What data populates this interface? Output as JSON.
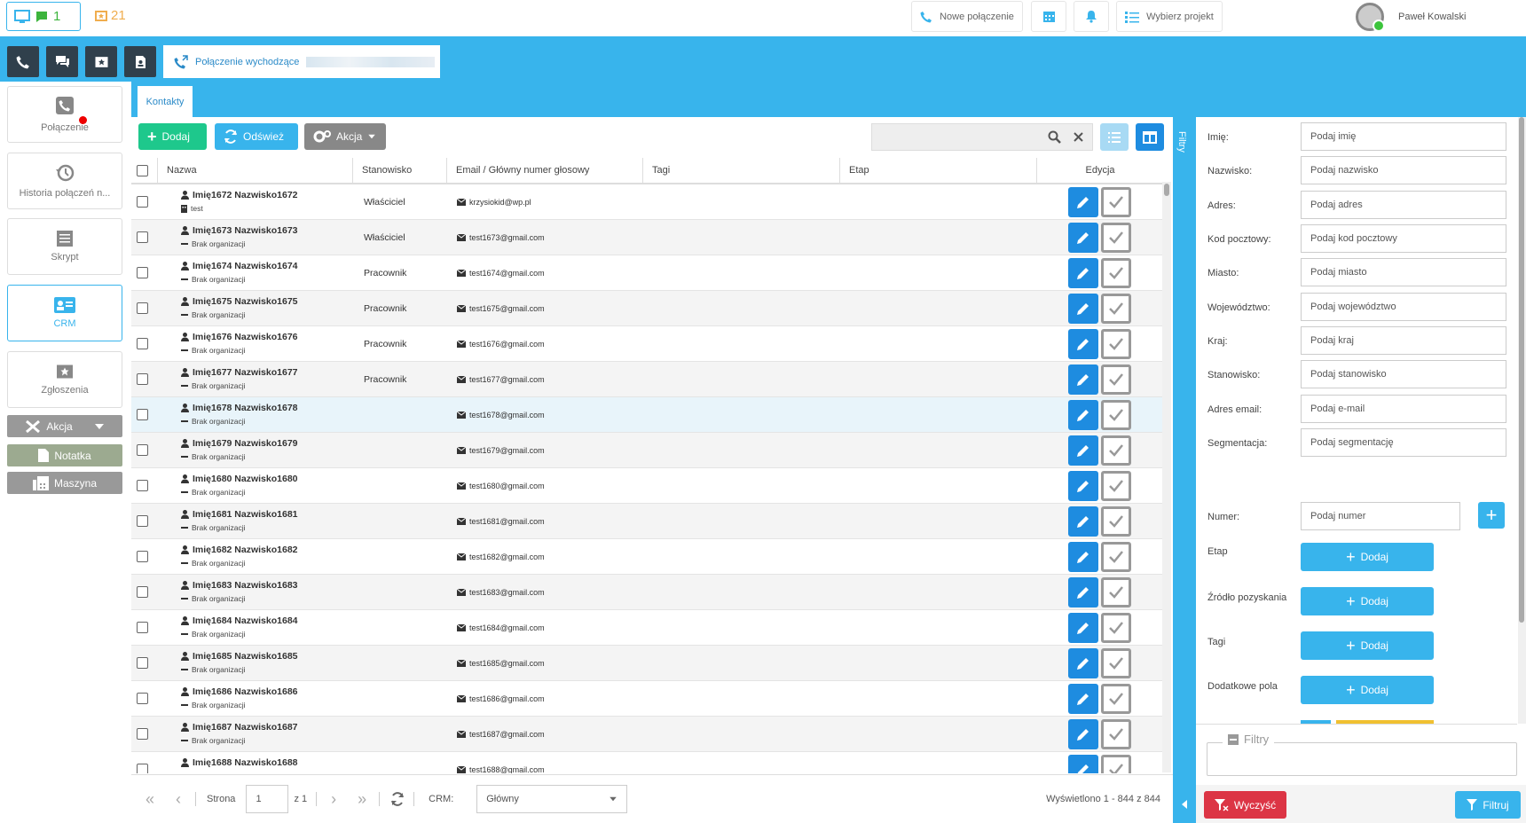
{
  "topbar": {
    "status_count": "1",
    "tickets_count": "21",
    "new_call": "Nowe połączenie",
    "project": "Wybierz projekt",
    "user_name": "Paweł Kowalski"
  },
  "call_tab": {
    "label": "Połączenie wychodzące"
  },
  "tab": {
    "label": "Kontakty"
  },
  "sidebar": {
    "polaczenie": "Połączenie",
    "historia": "Historia połączeń n...",
    "skrypt": "Skrypt",
    "crm": "CRM",
    "zgloszenia": "Zgłoszenia",
    "akcja": "Akcja",
    "notatka": "Notatka",
    "maszyna": "Maszyna"
  },
  "toolbar": {
    "add": "Dodaj",
    "refresh": "Odśwież",
    "action": "Akcja"
  },
  "table": {
    "headers": {
      "name": "Nazwa",
      "position": "Stanowisko",
      "email": "Email / Główny numer głosowy",
      "tags": "Tagi",
      "stage": "Etap",
      "edit": "Edycja"
    },
    "rows": [
      {
        "name": "Imię1672 Nazwisko1672",
        "org": "test",
        "position": "Właściciel",
        "email": "krzysiokid@wp.pl"
      },
      {
        "name": "Imię1673 Nazwisko1673",
        "org": "Brak organizacji",
        "position": "Właściciel",
        "email": "test1673@gmail.com"
      },
      {
        "name": "Imię1674 Nazwisko1674",
        "org": "Brak organizacji",
        "position": "Pracownik",
        "email": "test1674@gmail.com"
      },
      {
        "name": "Imię1675 Nazwisko1675",
        "org": "Brak organizacji",
        "position": "Pracownik",
        "email": "test1675@gmail.com"
      },
      {
        "name": "Imię1676 Nazwisko1676",
        "org": "Brak organizacji",
        "position": "Pracownik",
        "email": "test1676@gmail.com"
      },
      {
        "name": "Imię1677 Nazwisko1677",
        "org": "Brak organizacji",
        "position": "Pracownik",
        "email": "test1677@gmail.com"
      },
      {
        "name": "Imię1678 Nazwisko1678",
        "org": "Brak organizacji",
        "position": "",
        "email": "test1678@gmail.com"
      },
      {
        "name": "Imię1679 Nazwisko1679",
        "org": "Brak organizacji",
        "position": "",
        "email": "test1679@gmail.com"
      },
      {
        "name": "Imię1680 Nazwisko1680",
        "org": "Brak organizacji",
        "position": "",
        "email": "test1680@gmail.com"
      },
      {
        "name": "Imię1681 Nazwisko1681",
        "org": "Brak organizacji",
        "position": "",
        "email": "test1681@gmail.com"
      },
      {
        "name": "Imię1682 Nazwisko1682",
        "org": "Brak organizacji",
        "position": "",
        "email": "test1682@gmail.com"
      },
      {
        "name": "Imię1683 Nazwisko1683",
        "org": "Brak organizacji",
        "position": "",
        "email": "test1683@gmail.com"
      },
      {
        "name": "Imię1684 Nazwisko1684",
        "org": "Brak organizacji",
        "position": "",
        "email": "test1684@gmail.com"
      },
      {
        "name": "Imię1685 Nazwisko1685",
        "org": "Brak organizacji",
        "position": "",
        "email": "test1685@gmail.com"
      },
      {
        "name": "Imię1686 Nazwisko1686",
        "org": "Brak organizacji",
        "position": "",
        "email": "test1686@gmail.com"
      },
      {
        "name": "Imię1687 Nazwisko1687",
        "org": "Brak organizacji",
        "position": "",
        "email": "test1687@gmail.com"
      },
      {
        "name": "Imię1688 Nazwisko1688",
        "org": "",
        "position": "",
        "email": "test1688@gmail.com"
      }
    ]
  },
  "pagination": {
    "page_label": "Strona",
    "page_value": "1",
    "of_label": "z 1",
    "crm_label": "CRM:",
    "crm_value": "Główny",
    "summary": "Wyświetlono 1 - 844 z 844"
  },
  "filters": {
    "strip_label": "Filtry",
    "fields": [
      {
        "label": "Imię:",
        "placeholder": "Podaj imię"
      },
      {
        "label": "Nazwisko:",
        "placeholder": "Podaj nazwisko"
      },
      {
        "label": "Adres:",
        "placeholder": "Podaj adres"
      },
      {
        "label": "Kod pocztowy:",
        "placeholder": "Podaj kod pocztowy"
      },
      {
        "label": "Miasto:",
        "placeholder": "Podaj miasto"
      },
      {
        "label": "Województwo:",
        "placeholder": "Podaj województwo"
      },
      {
        "label": "Kraj:",
        "placeholder": "Podaj kraj"
      },
      {
        "label": "Stanowisko:",
        "placeholder": "Podaj stanowisko"
      },
      {
        "label": "Adres email:",
        "placeholder": "Podaj e-mail"
      },
      {
        "label": "Segmentacja:",
        "placeholder": "Podaj segmentację"
      }
    ],
    "numer_label": "Numer:",
    "numer_placeholder": "Podaj numer",
    "etap": "Etap",
    "zrodlo": "Źródło pozyskania",
    "tagi": "Tagi",
    "dodatkowe": "Dodatkowe pola",
    "add": "Dodaj",
    "fieldset_legend": "Filtry",
    "clear": "Wyczyść",
    "filter": "Filtruj"
  },
  "colors": {
    "accent": "#38b4ec",
    "green": "#1ec88c",
    "dark": "#30404c",
    "red": "#dc3545"
  }
}
